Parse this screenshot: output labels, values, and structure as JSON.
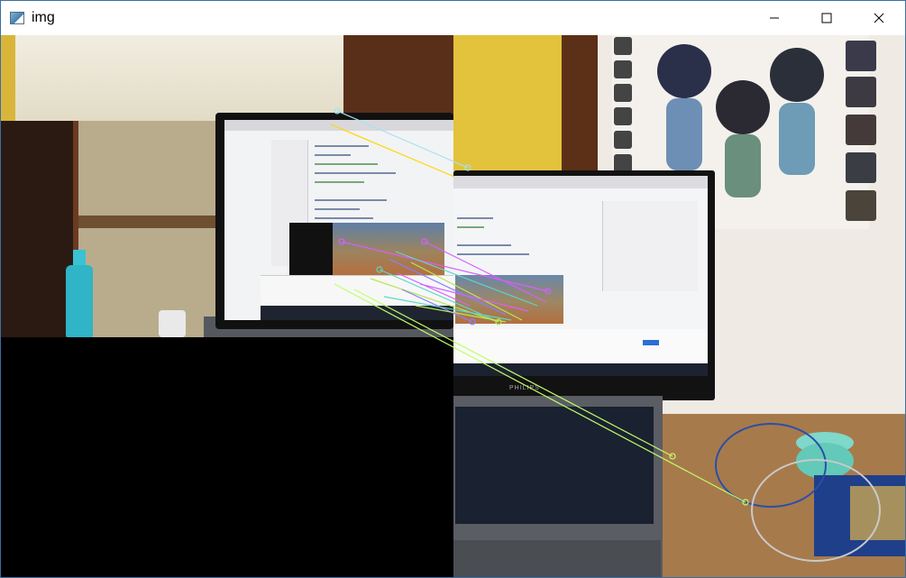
{
  "window": {
    "title": "img",
    "icon": "image-viewer-icon",
    "controls": {
      "minimize_icon": "minimize-icon",
      "maximize_icon": "maximize-icon",
      "close_icon": "close-icon"
    }
  },
  "image": {
    "monitor_brand": "PHILIPS"
  },
  "colors": {
    "accent_titlebar_border": "#3a6ea5",
    "match_colors": [
      "#a6e3f0",
      "#ffd700",
      "#d75fff",
      "#b5e65a",
      "#5fd7c4",
      "#8a7fff",
      "#c0ff6a"
    ]
  }
}
